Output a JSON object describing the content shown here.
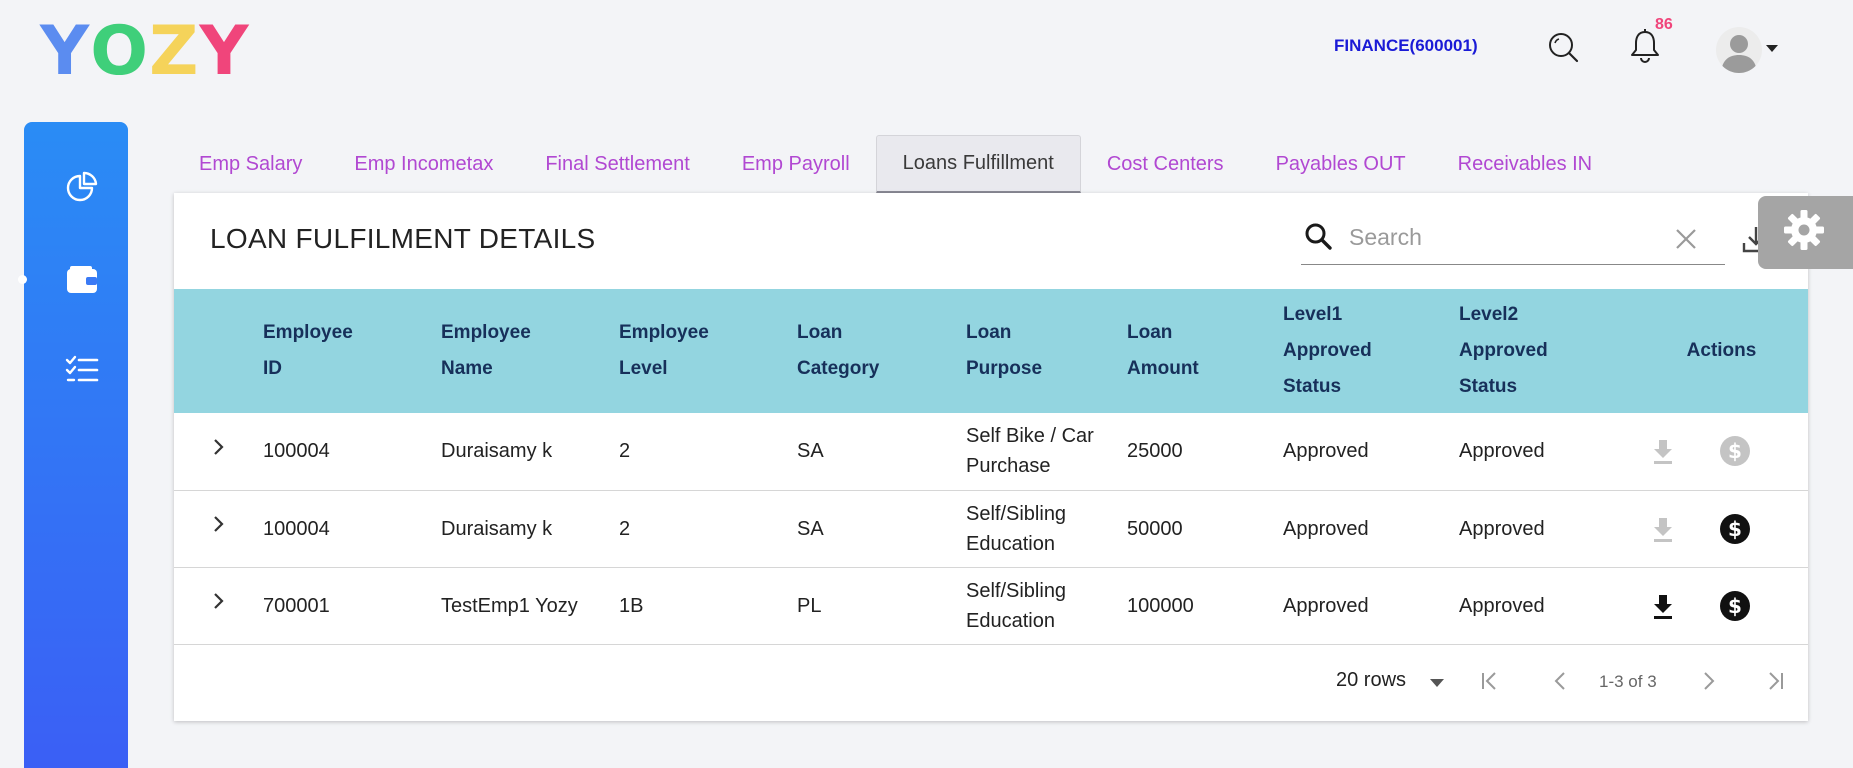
{
  "logo": {
    "letters": [
      "Y",
      "O",
      "Z",
      "Y"
    ],
    "colors": [
      "#5b8cf0",
      "#3fcf7a",
      "#f5d35a",
      "#f0457b"
    ]
  },
  "header": {
    "department": "FINANCE(600001)",
    "notification_count": "86",
    "icons": [
      "search-icon",
      "bell-icon",
      "avatar",
      "caret-down-icon"
    ]
  },
  "sidebar": {
    "items": [
      {
        "icon": "pie-chart-icon"
      },
      {
        "icon": "wallet-icon",
        "active": true
      },
      {
        "icon": "checklist-icon"
      }
    ]
  },
  "tabs": [
    {
      "label": "Emp Salary"
    },
    {
      "label": "Emp Incometax"
    },
    {
      "label": "Final Settlement"
    },
    {
      "label": "Emp Payroll"
    },
    {
      "label": "Loans Fulfillment",
      "active": true
    },
    {
      "label": "Cost Centers"
    },
    {
      "label": "Payables OUT"
    },
    {
      "label": "Receivables IN"
    }
  ],
  "card": {
    "title": "LOAN FULFILMENT DETAILS",
    "search_placeholder": "Search"
  },
  "table": {
    "columns": [
      {
        "line1": "Employee",
        "line2": "ID",
        "line3": ""
      },
      {
        "line1": "Employee",
        "line2": "Name",
        "line3": ""
      },
      {
        "line1": "Employee",
        "line2": "Level",
        "line3": ""
      },
      {
        "line1": "Loan",
        "line2": "Category",
        "line3": ""
      },
      {
        "line1": "Loan",
        "line2": "Purpose",
        "line3": ""
      },
      {
        "line1": "Loan",
        "line2": "Amount",
        "line3": ""
      },
      {
        "line1": "Level1",
        "line2": "Approved",
        "line3": "Status"
      },
      {
        "line1": "Level2",
        "line2": "Approved",
        "line3": "Status"
      },
      {
        "line1": "Actions",
        "line2": "",
        "line3": ""
      }
    ],
    "rows": [
      {
        "id": "100004",
        "name": "Duraisamy k",
        "level": "2",
        "category": "SA",
        "purpose": "Self Bike / Car Purchase",
        "amount": "25000",
        "level1": "Approved",
        "level2": "Approved",
        "download_enabled": false,
        "payment_enabled": false
      },
      {
        "id": "100004",
        "name": "Duraisamy k",
        "level": "2",
        "category": "SA",
        "purpose": "Self/Sibling Education",
        "amount": "50000",
        "level1": "Approved",
        "level2": "Approved",
        "download_enabled": false,
        "payment_enabled": true
      },
      {
        "id": "700001",
        "name": "TestEmp1 Yozy",
        "level": "1B",
        "category": "PL",
        "purpose": "Self/Sibling Education",
        "amount": "100000",
        "level1": "Approved",
        "level2": "Approved",
        "download_enabled": true,
        "payment_enabled": true
      }
    ]
  },
  "pagination": {
    "rows_per_page": "20 rows",
    "range": "1-3 of 3"
  },
  "colors": {
    "sidebar_top": "#2a8cf5",
    "sidebar_bottom": "#3b5ef5",
    "tab_text": "#b148d2",
    "table_header": "#93d5e0",
    "department": "#1a1ad6",
    "badge": "#f0457b"
  }
}
